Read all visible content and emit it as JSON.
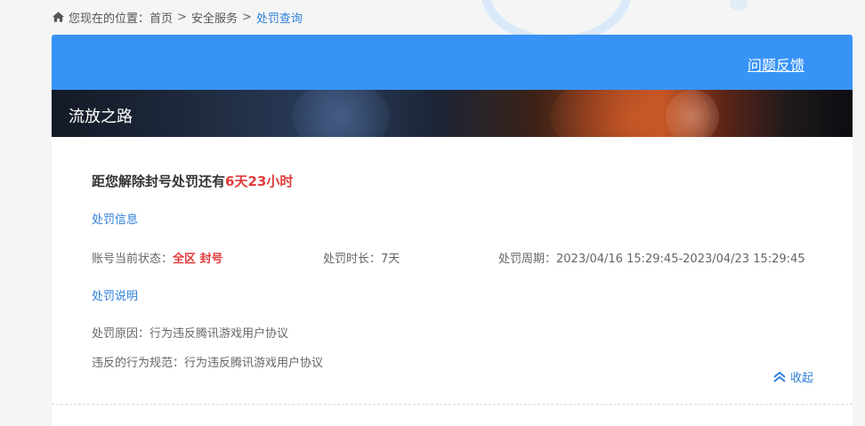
{
  "breadcrumb": {
    "label": "您现在的位置：",
    "items": [
      "首页",
      "安全服务",
      "处罚查询"
    ],
    "separator": ">"
  },
  "header": {
    "feedback_label": "问题反馈",
    "game_title": "流放之路"
  },
  "penalty": {
    "headline_prefix": "距您解除封号处罚还有",
    "remaining": "6天23小时",
    "info_title": "处罚信息",
    "status_label": "账号当前状态：",
    "status_value": "全区 封号",
    "duration_label": "处罚时长：",
    "duration_value": "7天",
    "period_label": "处罚周期：",
    "period_value": "2023/04/16 15:29:45-2023/04/23 15:29:45",
    "explain_title": "处罚说明",
    "reason_label": "处罚原因：",
    "reason_value": "行为违反腾讯游戏用户协议",
    "rule_label": "违反的行为规范：",
    "rule_value": "行为违反腾讯游戏用户协议",
    "collapse_label": "收起"
  },
  "colors": {
    "accent": "#3893f6",
    "link": "#2f7fd9",
    "alert": "#e03c3c"
  },
  "icons": {
    "home": "home-icon",
    "collapse": "double-chevron-up-icon"
  }
}
